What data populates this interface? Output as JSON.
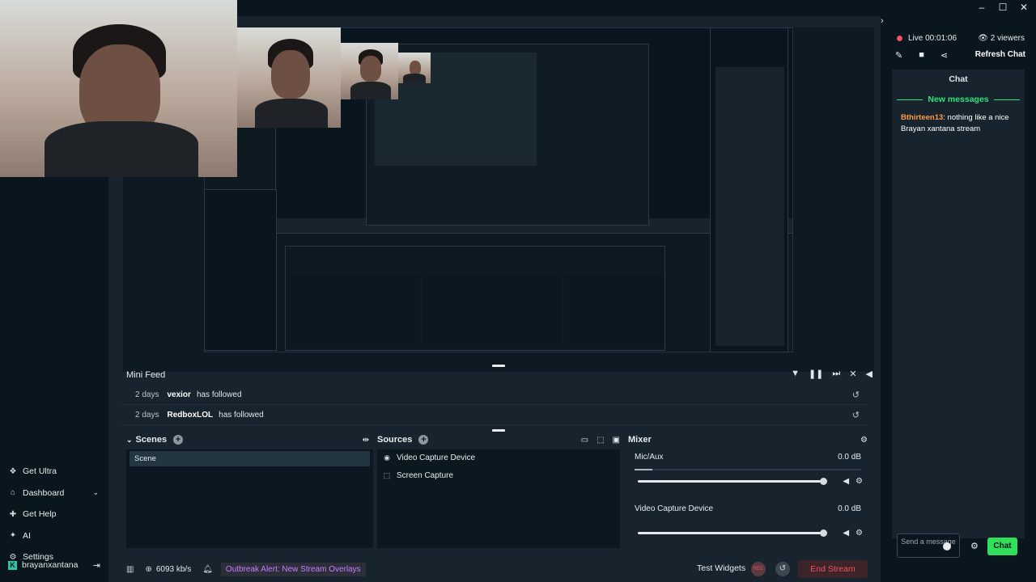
{
  "window": {
    "minimize": "–",
    "maximize": "☐",
    "close": "✕"
  },
  "sidebar": {
    "items": [
      {
        "label": "Get Ultra",
        "icon": "ultra-icon"
      },
      {
        "label": "Dashboard",
        "icon": "dashboard-icon"
      },
      {
        "label": "Get Help",
        "icon": "help-icon"
      },
      {
        "label": "AI",
        "icon": "ai-icon"
      },
      {
        "label": "Settings",
        "icon": "settings-icon"
      }
    ],
    "user": "brayanxantana"
  },
  "mini_feed": {
    "title": "Mini Feed",
    "rows": [
      {
        "when": "2 days",
        "who": "vexior",
        "action": "has followed"
      },
      {
        "when": "2 days",
        "who": "RedboxLOL",
        "action": "has followed"
      }
    ]
  },
  "scenes": {
    "title": "Scenes",
    "items": [
      "Scene"
    ]
  },
  "sources": {
    "title": "Sources",
    "items": [
      "Video Capture Device",
      "Screen Capture"
    ]
  },
  "mixer": {
    "title": "Mixer",
    "channels": [
      {
        "name": "Mic/Aux",
        "db": "0.0 dB"
      },
      {
        "name": "Video Capture Device",
        "db": "0.0 dB"
      }
    ]
  },
  "footer": {
    "bitrate": "6093 kb/s",
    "alert": "Outbreak Alert: New Stream Overlays",
    "test_widgets": "Test Widgets",
    "rec": "REC",
    "end_stream": "End Stream"
  },
  "chat": {
    "live": "Live 00:01:06",
    "viewers": "2 viewers",
    "refresh": "Refresh Chat",
    "title": "Chat",
    "new_messages": "New messages",
    "message_user": "Bthirteen13",
    "message_text": ": nothing like a nice Brayan xantana stream",
    "placeholder": "Send a message",
    "send": "Chat"
  },
  "colors": {
    "background": "#17242d",
    "sidebar": "#09161d",
    "accent_green": "#31e05a",
    "end_red": "#f0525f",
    "alert_purple": "#c77dff"
  }
}
